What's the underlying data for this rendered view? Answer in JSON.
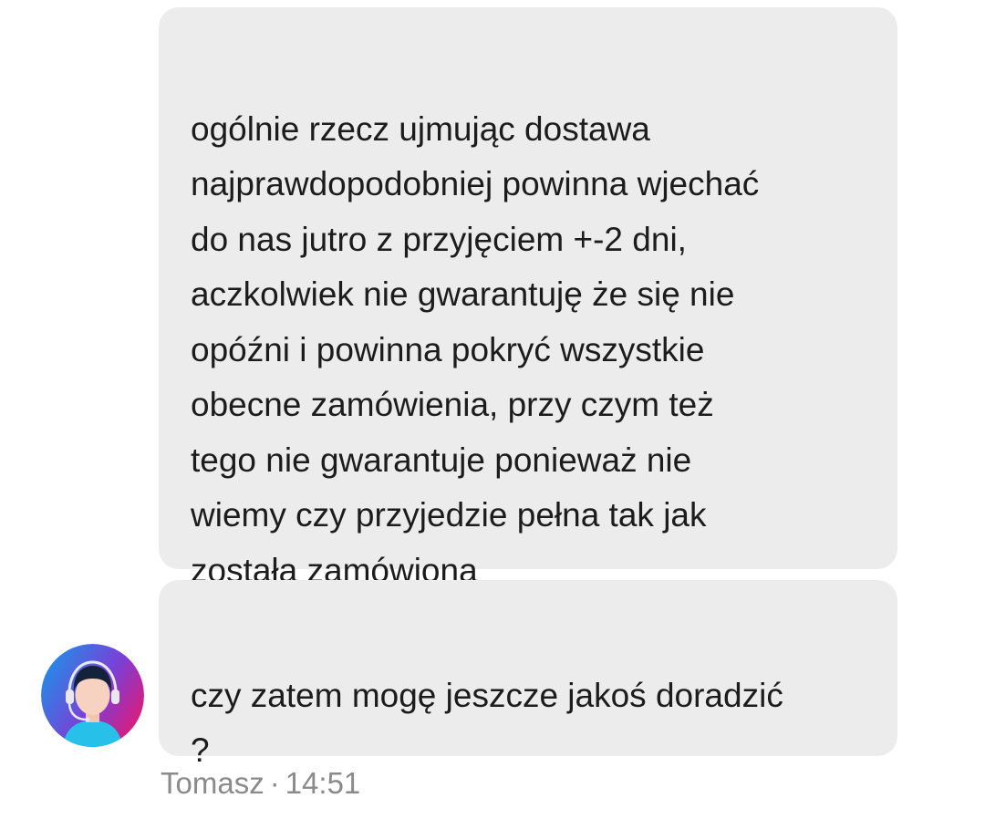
{
  "conversation": {
    "messages": [
      {
        "text": "ogólnie rzecz ujmując dostawa\nnajprawdopodobniej powinna wjechać\ndo nas jutro z przyjęciem +-2 dni,\naczkolwiek nie gwarantuję że się nie\nopóźni i powinna pokryć wszystkie\nobecne zamówienia, przy czym też\ntego nie gwarantuje ponieważ nie\nwiemy czy przyjedzie pełna tak jak\nzostała zamówiona"
      },
      {
        "text": "czy zatem mogę jeszcze jakoś doradzić\n?"
      }
    ],
    "sender": {
      "name": "Tomasz",
      "separator": "·",
      "time": "14:51",
      "avatar_icon": "support-agent-icon"
    }
  },
  "colors": {
    "bubble_bg": "#ececec",
    "meta_text": "#8a8a8a",
    "avatar_gradient_start": "#1e90e8",
    "avatar_gradient_mid": "#7b3fd6",
    "avatar_gradient_end": "#e8176f"
  }
}
